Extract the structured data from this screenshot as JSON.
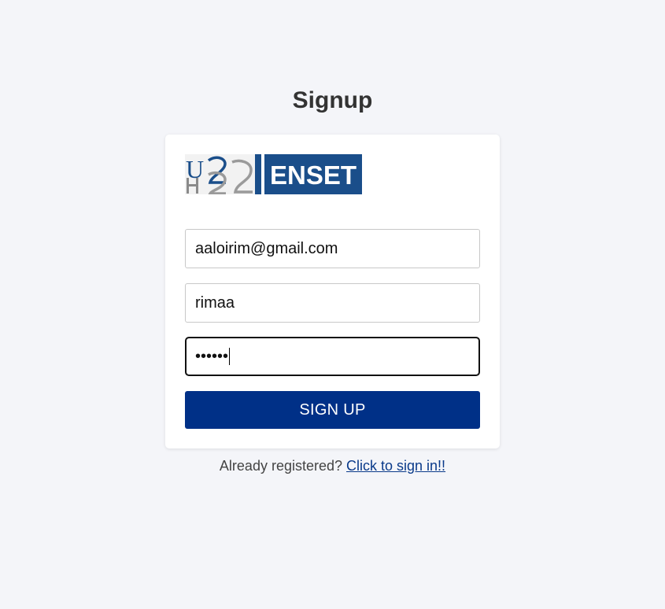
{
  "page": {
    "title": "Signup"
  },
  "logo": {
    "name": "UH2C ENSET logo",
    "left_text": "U",
    "right_text": "ENSET",
    "brand_color": "#1a4e8a"
  },
  "form": {
    "email_value": "aaloirim@gmail.com",
    "username_value": "rimaa",
    "password_mask": "••••••",
    "submit_label": "SIGN UP",
    "button_color": "#003087"
  },
  "footer": {
    "prompt": "Already registered? ",
    "link_label": "Click to sign in!!"
  }
}
